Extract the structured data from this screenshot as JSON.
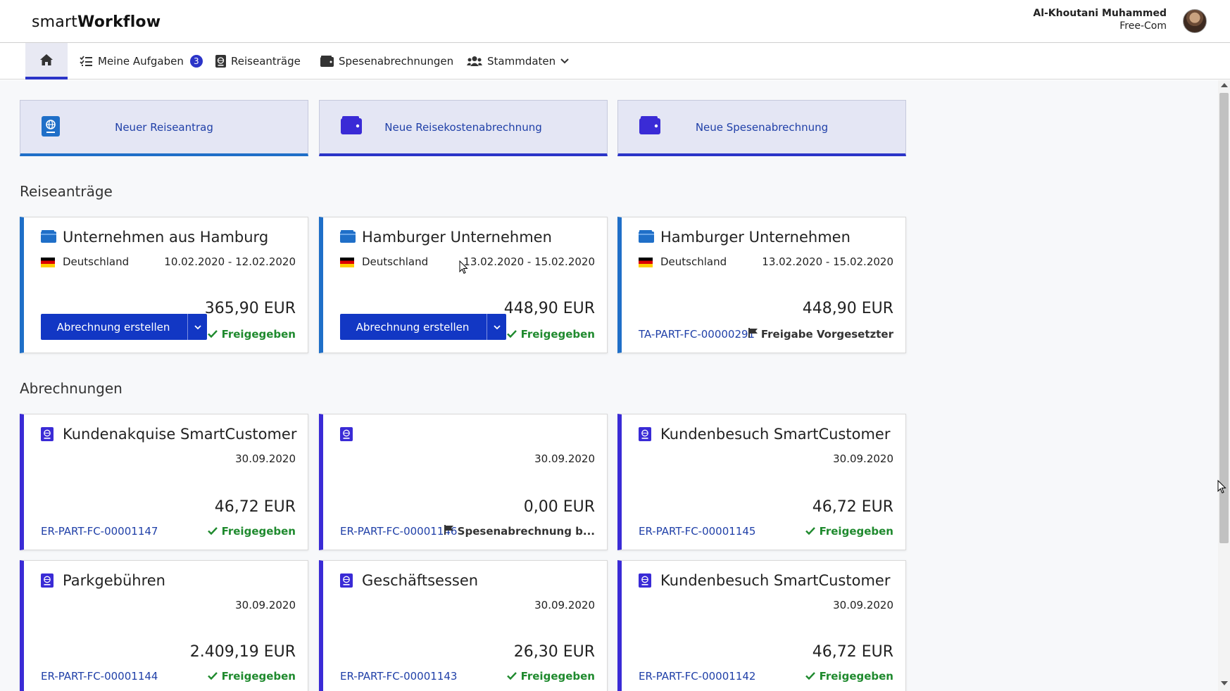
{
  "header": {
    "logo_light": "smart",
    "logo_bold": "Workflow",
    "user_name": "Al-Khoutani Muhammed",
    "user_company": "Free-Com"
  },
  "nav": {
    "items": [
      {
        "label": "Meine Aufgaben",
        "badge": "3",
        "icon": "tasks-icon"
      },
      {
        "label": "Reiseanträge",
        "icon": "passport-icon"
      },
      {
        "label": "Spesenabrechnungen",
        "icon": "wallet-icon"
      },
      {
        "label": "Stammdaten",
        "icon": "users-icon"
      }
    ]
  },
  "actions": [
    {
      "label": "Neuer Reiseantrag",
      "icon": "passport-icon"
    },
    {
      "label": "Neue Reisekostenabrechnung",
      "icon": "wallet-icon"
    },
    {
      "label": "Neue Spesenabrechnung",
      "icon": "wallet-icon"
    }
  ],
  "sections": {
    "reiseantraege": "Reiseanträge",
    "abrechnungen": "Abrechnungen"
  },
  "travel_cards": [
    {
      "title": "Unternehmen aus Hamburg",
      "country": "Deutschland",
      "dates": "10.02.2020 - 12.02.2020",
      "amount": "365,90 EUR",
      "button": "Abrechnung erstellen",
      "status": "Freigegeben"
    },
    {
      "title": "Hamburger Unternehmen",
      "country": "Deutschland",
      "dates": "13.02.2020 - 15.02.2020",
      "amount": "448,90 EUR",
      "button": "Abrechnung erstellen",
      "status": "Freigegeben"
    },
    {
      "title": "Hamburger Unternehmen",
      "country": "Deutschland",
      "dates": "13.02.2020 - 15.02.2020",
      "amount": "448,90 EUR",
      "ref": "TA-PART-FC-00000291",
      "status": "Freigabe Vorgesetzter"
    }
  ],
  "expense_cards": [
    {
      "title": "Kundenakquise SmartCustomer",
      "date": "30.09.2020",
      "amount": "46,72 EUR",
      "ref": "ER-PART-FC-00001147",
      "status": "Freigegeben"
    },
    {
      "title": "",
      "date": "30.09.2020",
      "amount": "0,00 EUR",
      "ref": "ER-PART-FC-00001146",
      "status": "Spesenabrechnung b..."
    },
    {
      "title": "Kundenbesuch SmartCustomer",
      "date": "30.09.2020",
      "amount": "46,72 EUR",
      "ref": "ER-PART-FC-00001145",
      "status": "Freigegeben"
    },
    {
      "title": "Parkgebühren",
      "date": "30.09.2020",
      "amount": "2.409,19 EUR",
      "ref": "ER-PART-FC-00001144",
      "status": "Freigegeben"
    },
    {
      "title": "Geschäftsessen",
      "date": "30.09.2020",
      "amount": "26,30 EUR",
      "ref": "ER-PART-FC-00001143",
      "status": "Freigegeben"
    },
    {
      "title": "Kundenbesuch SmartCustomer",
      "date": "30.09.2020",
      "amount": "46,72 EUR",
      "ref": "ER-PART-FC-00001142",
      "status": "Freigegeben"
    }
  ],
  "colors": {
    "primary": "#1237c4",
    "accent_blue": "#1f6fc8",
    "accent_purple": "#3a2bd6",
    "success": "#1f8a2e"
  }
}
